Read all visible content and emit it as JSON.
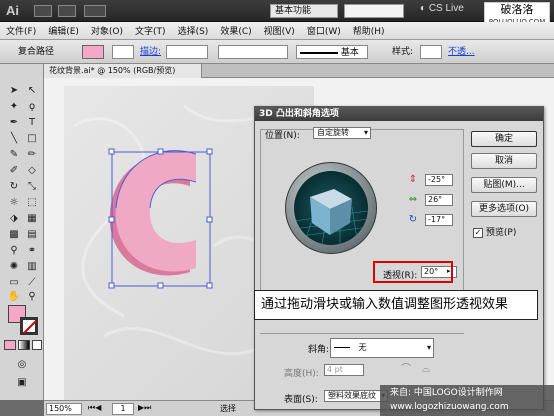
{
  "titlebar": {
    "app_logo": "Ai",
    "workspace": "基本功能",
    "cs_live": "CS Live",
    "site_watermark_main": "破洛洛",
    "site_watermark_sub": "POLUOLUO.COM"
  },
  "menu": [
    "文件(F)",
    "编辑(E)",
    "对象(O)",
    "文字(T)",
    "选择(S)",
    "效果(C)",
    "视图(V)",
    "窗口(W)",
    "帮助(H)"
  ],
  "controlbar": {
    "object_type": "复合路径",
    "stroke_label": "描边:",
    "stroke_style": "基本",
    "style_label": "样式:",
    "opacity_label": "不透..."
  },
  "document": {
    "tab_title": "花纹背景.ai* @ 150% (RGB/预览)"
  },
  "statusbar": {
    "zoom": "150%",
    "page": "1",
    "tool": "选择"
  },
  "dialog": {
    "title": "3D 凸出和斜角选项",
    "position_label": "位置(N):",
    "position_value": "自定旋转",
    "x_angle": "-25°",
    "y_angle": "26°",
    "z_angle": "-17°",
    "perspective_label": "透视(R):",
    "perspective_value": "20°",
    "bevel_label": "斜角:",
    "bevel_value": "无",
    "height_label": "高度(H):",
    "height_value": "4 pt",
    "surface_label": "表面(S):",
    "surface_value": "塑料效果底纹",
    "buttons": {
      "ok": "确定",
      "cancel": "取消",
      "map": "贴图(M)...",
      "more": "更多选项(O)",
      "preview": "预览(P)"
    }
  },
  "annotation": "通过拖动滑块或输入数值调整图形透视效果",
  "footer_watermark": {
    "line1": "来自: 中国LOGO设计制作网",
    "line2": "www.logozhizuowang.com"
  },
  "colors": {
    "fill": "#f5a8c6",
    "callout_border": "#dd0000"
  }
}
